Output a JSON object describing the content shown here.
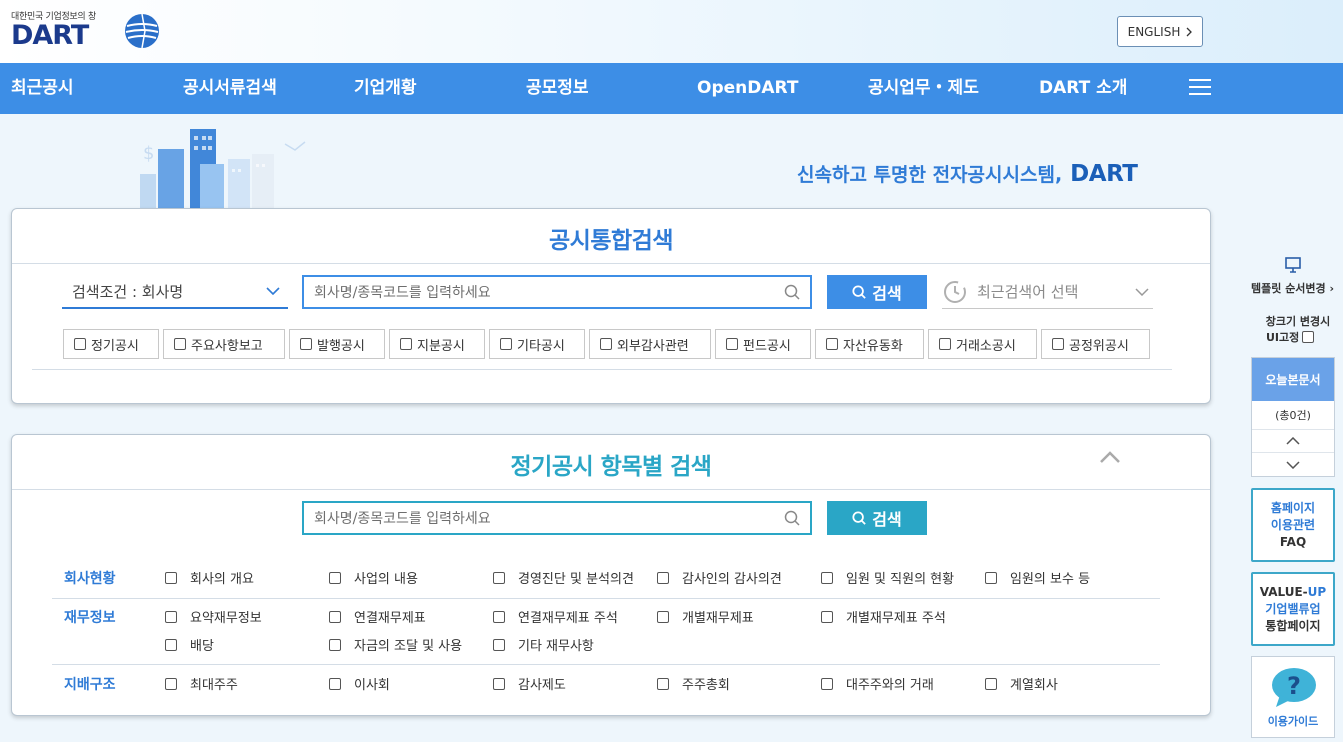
{
  "header": {
    "logo_tagline": "대한민국 기업정보의 창",
    "logo_text": "DART",
    "english_button": "ENGLISH"
  },
  "nav": {
    "items": [
      "최근공시",
      "공시서류검색",
      "기업개황",
      "공모정보",
      "OpenDART",
      "공시업무・제도",
      "DART 소개"
    ]
  },
  "hero": {
    "slogan": "신속하고 투명한 전자공시시스템,",
    "slogan_brand": "DART"
  },
  "integrated_search": {
    "title": "공시통합검색",
    "condition_label": "검색조건 : 회사명",
    "search_placeholder": "회사명/종목코드를 입력하세요",
    "search_button": "검색",
    "recent_placeholder": "최근검색어 선택",
    "filters": [
      "정기공시",
      "주요사항보고",
      "발행공시",
      "지분공시",
      "기타공시",
      "외부감사관련",
      "펀드공시",
      "자산유동화",
      "거래소공시",
      "공정위공시"
    ]
  },
  "periodic_search": {
    "title": "정기공시 항목별 검색",
    "search_placeholder": "회사명/종목코드를 입력하세요",
    "search_button": "검색",
    "categories": [
      {
        "label": "회사현황",
        "items": [
          "회사의 개요",
          "사업의 내용",
          "경영진단 및 분석의견",
          "감사인의 감사의견",
          "임원 및 직원의 현황",
          "임원의 보수 등"
        ]
      },
      {
        "label": "재무정보",
        "items": [
          "요약재무정보",
          "연결재무제표",
          "연결재무제표 주석",
          "개별재무제표",
          "개별재무제표 주석",
          "배당",
          "자금의 조달 및 사용",
          "기타 재무사항"
        ]
      },
      {
        "label": "지배구조",
        "items": [
          "최대주주",
          "이사회",
          "감사제도",
          "주주총회",
          "대주주와의 거래",
          "계열회사"
        ]
      }
    ]
  },
  "rail": {
    "template_order": "템플릿 순서변경",
    "window_size_line1": "창크기 변경시",
    "window_size_line2": "UI고정",
    "today_docs_title": "오늘본문서",
    "today_docs_count": "(총0건)",
    "faq_line1": "홈페이지",
    "faq_line2": "이용관련",
    "faq_line3": "FAQ",
    "valueup_line1a": "VALUE-",
    "valueup_line1b": "UP",
    "valueup_line2": "기업밸류업",
    "valueup_line3": "통합페이지",
    "guide_label": "이용가이드"
  }
}
